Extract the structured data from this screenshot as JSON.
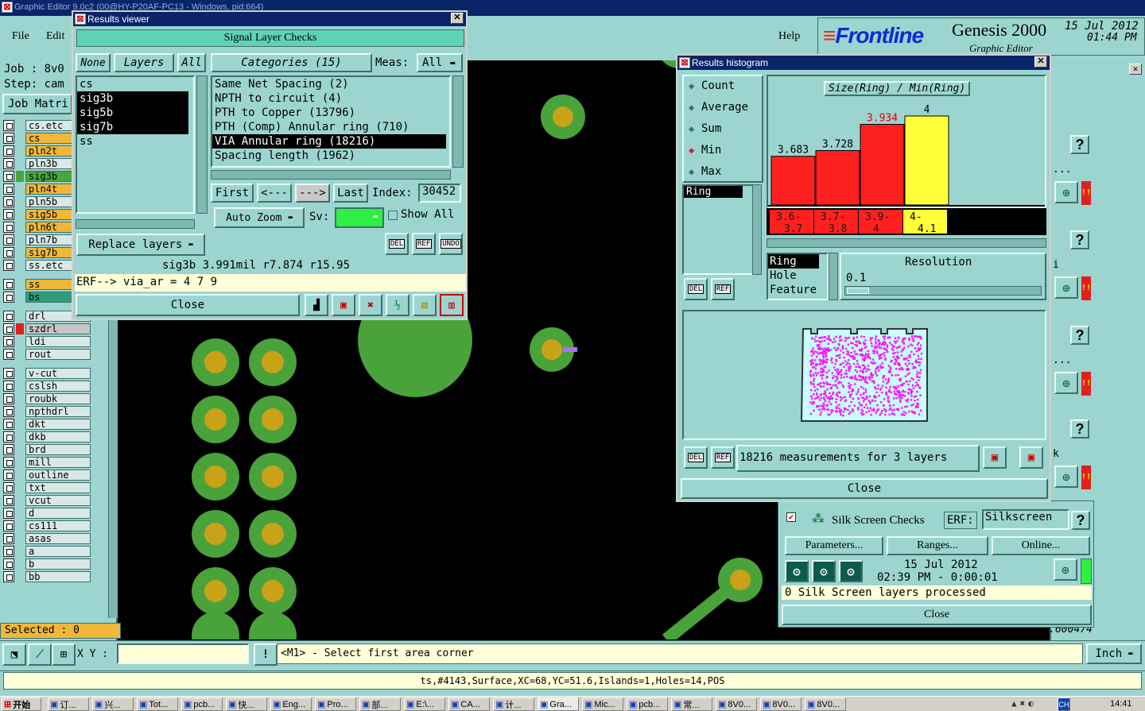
{
  "main_window": {
    "title": "Graphic Editor 9.0c2 (00@HY-P20AF-PC13 - Windows, pid:664)"
  },
  "menu": {
    "file": "File",
    "edit": "Edit",
    "help": "Help"
  },
  "brand": {
    "logo": "Frontline",
    "product": "Genesis 2000",
    "subtitle": "Graphic Editor",
    "date": "15 Jul 2012",
    "time": "01:44 PM"
  },
  "job": {
    "job_label": "Job  : 8v0",
    "step_label": "Step: cam",
    "matrix_btn": "Job Matri"
  },
  "layers": [
    {
      "name": "cs.etc",
      "color": "#d8e8e6"
    },
    {
      "name": "cs",
      "color": "#f0b83a"
    },
    {
      "name": "pln2t",
      "color": "#f0b83a"
    },
    {
      "name": "pln3b",
      "color": "#d8e8e6"
    },
    {
      "name": "sig3b",
      "color": "#4aa63b"
    },
    {
      "name": "pln4t",
      "color": "#f0b83a"
    },
    {
      "name": "pln5b",
      "color": "#d8e8e6"
    },
    {
      "name": "sig5b",
      "color": "#f0b83a"
    },
    {
      "name": "pln6t",
      "color": "#f0b83a"
    },
    {
      "name": "pln7b",
      "color": "#d8e8e6"
    },
    {
      "name": "sig7b",
      "color": "#f0b83a"
    },
    {
      "name": "ss.etc",
      "color": "#d8e8e6"
    },
    {
      "name": "ss",
      "color": "#f0b83a"
    },
    {
      "name": "bs",
      "color": "#2f9c7a"
    },
    {
      "name": "drl",
      "color": "#d8e8e6"
    },
    {
      "name": "szdrl",
      "color": "#c6c6c6"
    },
    {
      "name": "ldi",
      "color": "#d8e8e6"
    },
    {
      "name": "rout",
      "color": "#d8e8e6"
    },
    {
      "name": "v-cut",
      "color": "#d8e8e6"
    },
    {
      "name": "cslsh",
      "color": "#d8e8e6"
    },
    {
      "name": "roubk",
      "color": "#d8e8e6"
    },
    {
      "name": "npthdrl",
      "color": "#d8e8e6"
    },
    {
      "name": "dkt",
      "color": "#d8e8e6"
    },
    {
      "name": "dkb",
      "color": "#d8e8e6"
    },
    {
      "name": "brd",
      "color": "#d8e8e6"
    },
    {
      "name": "mill",
      "color": "#d8e8e6"
    },
    {
      "name": "outline",
      "color": "#d8e8e6"
    },
    {
      "name": "txt",
      "color": "#d8e8e6"
    },
    {
      "name": "vcut",
      "color": "#d8e8e6"
    },
    {
      "name": "d",
      "color": "#d8e8e6"
    },
    {
      "name": "cs111",
      "color": "#d8e8e6"
    },
    {
      "name": "asas",
      "color": "#d8e8e6"
    },
    {
      "name": "a",
      "color": "#d8e8e6"
    },
    {
      "name": "b",
      "color": "#d8e8e6"
    },
    {
      "name": "bb",
      "color": "#d8e8e6"
    }
  ],
  "selected": "Selected : 0",
  "results_viewer": {
    "title": "Results viewer",
    "header": "Signal Layer Checks",
    "none_btn": "None",
    "layers_btn": "Layers",
    "all_btn": "All",
    "categories_btn": "Categories (15)",
    "meas_label": "Meas:",
    "meas_value": "All",
    "layer_list": [
      "cs",
      "sig3b",
      "sig5b",
      "sig7b",
      "ss"
    ],
    "categories": [
      "Same Net Spacing (2)",
      "NPTH to circuit (4)",
      "PTH to Copper (13796)",
      "PTH (Comp) Annular ring (710)",
      "VIA Annular ring (18216)",
      "Spacing length (1962)"
    ],
    "first": "First",
    "prev": "<---",
    "next": "--->",
    "last": "Last",
    "index_label": "Index:",
    "index_value": "30452",
    "auto_zoom": "Auto Zoom",
    "sv_label": "Sv:",
    "show_all": "Show All",
    "replace_layers": "Replace layers",
    "del": "DEL",
    "ref": "REF",
    "undo": "UNDO",
    "info_line": "sig3b 3.991mil  r7.874  r15.95",
    "erf_line": "ERF--> via_ar = 4 7 9",
    "close": "Close"
  },
  "histogram": {
    "title": "Results histogram",
    "modes": [
      "Count",
      "Average",
      "Sum",
      "Min",
      "Max"
    ],
    "selected_mode": "Min",
    "chart_title": "Size(Ring) / Min(Ring)",
    "attr_list": [
      "Ring"
    ],
    "ranges": [
      "Ring",
      "Hole",
      "Feature"
    ],
    "resolution_label": "Resolution",
    "resolution_value": "0.1",
    "summary": "18216 measurements for 3 layers",
    "close": "Close",
    "del": "DEL",
    "ref": "REF"
  },
  "chart_data": {
    "type": "bar",
    "title": "Size(Ring) / Min(Ring)",
    "categories": [
      "3.6-3.7",
      "3.7-3.8",
      "3.9-4",
      "4-4.1"
    ],
    "values": [
      3.683,
      3.728,
      3.934,
      4
    ],
    "value_labels": [
      "3.683",
      "3.728",
      "3.934",
      "4"
    ],
    "bins_top": [
      "3.6-",
      "3.7-",
      "3.9-",
      "4-"
    ],
    "bins_bottom": [
      "3.7",
      "3.8",
      "4",
      "4.1"
    ],
    "colors": [
      "#ff2020",
      "#ff2020",
      "#ff2020",
      "#ffff3a"
    ],
    "ylim": [
      3.3,
      4.05
    ]
  },
  "silk": {
    "title": "Silk Screen Checks",
    "erf_label": "ERF:",
    "erf_value": "Silkscreen",
    "parameters": "Parameters...",
    "ranges": "Ranges...",
    "online": "Online...",
    "date": "15 Jul 2012",
    "time": "02:39 PM - 0:00:01",
    "status": "0 Silk Screen layers processed",
    "close": "Close",
    "help": "?"
  },
  "right_panel": {
    "help": "?",
    "coord": "Y = 2.600474",
    "fragments": [
      "...",
      "i",
      "...",
      "k",
      "..."
    ]
  },
  "bottom": {
    "xy_label": "X Y :",
    "xy_value": "",
    "prompt": "<M1> - Select first area corner",
    "units": "Inch",
    "status_line": "ts,#4143,Surface,XC=68,YC=51.6,Islands=1,Holes=14,POS"
  },
  "taskbar": {
    "start": "开始",
    "items": [
      "订...",
      "兴...",
      "Tot...",
      "pcb...",
      "快...",
      "Eng...",
      "Pro...",
      "部...",
      "E:\\...",
      "CA...",
      "计...",
      "Gra...",
      "Mic...",
      "pcb...",
      "常...",
      "8V0...",
      "8V0...",
      "8V0..."
    ],
    "clock": "14:41",
    "lang": "CH"
  }
}
